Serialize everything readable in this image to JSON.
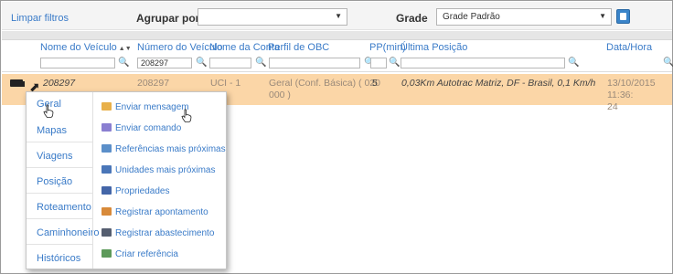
{
  "toolbar": {
    "clear_filters": "Limpar filtros",
    "group_by_label": "Agrupar por",
    "group_by_value": "",
    "grid_label": "Grade",
    "grid_value": "Grade Padrão"
  },
  "columns": [
    {
      "label": "Nome do Veículo",
      "sorted": true
    },
    {
      "label": "Número do Veículo"
    },
    {
      "label": "Nome da Conta"
    },
    {
      "label": "Perfil de OBC"
    },
    {
      "label": "PP(min)"
    },
    {
      "label": "Última Posição"
    },
    {
      "label": "Data/Hora"
    }
  ],
  "filters": {
    "vehicle_name": "",
    "vehicle_number": "208297",
    "account_name": "",
    "obc_profile": "",
    "pp": "",
    "last_position": ""
  },
  "row": {
    "vehicle_name": "208297",
    "vehicle_number": "208297",
    "account_name": "UCI - 1",
    "obc_profile_line1": "Geral (Conf. Básica) ( 020",
    "obc_profile_line2": "000 )",
    "pp": "5",
    "last_position": "0,03Km Autotrac Matriz, DF - Brasil, 0,1 Km/h",
    "datetime_line1": "13/10/2015 11:36:",
    "datetime_line2": "24"
  },
  "menu": {
    "left": [
      "Geral",
      "Mapas",
      "Viagens",
      "Posição",
      "Roteamento",
      "Caminhoneiro",
      "Históricos"
    ],
    "right": [
      {
        "label": "Enviar mensagem",
        "icon": "envelope-icon"
      },
      {
        "label": "Enviar comando",
        "icon": "command-icon"
      },
      {
        "label": "Referências mais próximas",
        "icon": "references-icon"
      },
      {
        "label": "Unidades mais próximas",
        "icon": "truck-icon"
      },
      {
        "label": "Propriedades",
        "icon": "properties-icon"
      },
      {
        "label": "Registrar apontamento",
        "icon": "pencil-icon"
      },
      {
        "label": "Registrar abastecimento",
        "icon": "fuel-icon"
      },
      {
        "label": "Criar referência",
        "icon": "create-reference-icon"
      }
    ]
  },
  "colors": {
    "link": "#3a7bc8",
    "selected_row": "#fbd6a7",
    "save_button": "#3a84c9"
  }
}
